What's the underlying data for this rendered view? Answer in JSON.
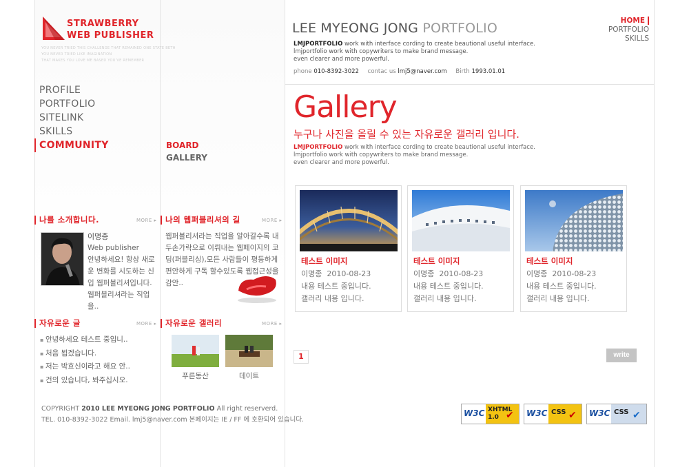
{
  "logo": {
    "line1": "STRAWBERRY",
    "line2": "WEB PUBLISHER",
    "tagline": [
      "YOU NEVER TRIED THIS CHALLENGE THAT REMAINED ONE STATE BETH",
      "YOU NEVER TRIED LIKE IMAGINATION",
      "THAT MAKES YOU LOVE ME BASED YOU'VE REMEMBER"
    ]
  },
  "menu": {
    "items": [
      "PROFILE",
      "PORTFOLIO",
      "SITELINK",
      "SKILLS",
      "COMMUNITY"
    ],
    "active": "COMMUNITY"
  },
  "submenu": [
    "BOARD",
    "GALLERY"
  ],
  "header": {
    "title_dark": "LEE MYEONG JONG",
    "title_light": "PORTFOLIO",
    "intro_brand": "LMJPORTFOLIO",
    "intro_line1": " work with interface cording to create beautional useful interface.",
    "intro_line2": "lmjportfolio work with copywriters to make brand message.",
    "intro_line3": "even clearer and more powerful.",
    "phone_label": "phone",
    "phone": "010-8392-3022",
    "contact_label": "contac us",
    "email": "lmj5@naver.com",
    "birth_label": "Birth",
    "birth": "1993.01.01"
  },
  "topnav": [
    "HOME",
    "PORTFOLIO",
    "SKILLS"
  ],
  "gallery": {
    "title": "Gallery",
    "subtitle": "누구나 사진을 올릴 수 있는 자유로운 갤러리 입니다.",
    "desc_brand": "LMJPORTFOLIO",
    "desc_line1": " work with interface cording to create beautional useful interface.",
    "desc_line2": "lmjportfolio work with copywriters to make brand message.",
    "desc_line3": "even clearer and more powerful.",
    "cards": [
      {
        "title": "테스트 이미지",
        "author": "이명종",
        "date": "2010-08-23",
        "line1": "내용 테스트 중입니다.",
        "line2": "갤러리 내용 입니다."
      },
      {
        "title": "테스트 이미지",
        "author": "이명종",
        "date": "2010-08-23",
        "line1": "내용 테스트 중입니다.",
        "line2": "갤러리 내용 입니다."
      },
      {
        "title": "테스트 이미지",
        "author": "이명종",
        "date": "2010-08-23",
        "line1": "내용 테스트 중입니다.",
        "line2": "갤러리 내용 입니다."
      }
    ],
    "page": "1",
    "write": "write"
  },
  "widgets": {
    "more": "MORE ▸",
    "intro_title": "나를 소개합니다.",
    "intro_name": "이명종",
    "intro_role": "Web publisher",
    "intro_text": "안녕하세요! 항상 새로운 변화를 시도하는 신입 웹퍼블리셔입니다. 웹퍼블리셔라는 직업을..",
    "road_title": "나의 웹퍼블리셔의 길",
    "road_text": "웹퍼블리셔라는 직업을 알아갈수록 내두손가락으로 이뤄내는 웹페이지의 코딩(퍼블리싱),모든 사람들이 평등하게 편안하게 구독 할수있도록 웹접근성을 감안..",
    "free_title": "자유로운 글",
    "free_items": [
      "안녕하세요 테스트 중입니..",
      "처음 뵙겠습니다.",
      "저는 박효신이라고 해요 안..",
      "건의 있습니다, 봐주십시오."
    ],
    "gal_title": "자유로운 갤러리",
    "gal_thumbs": [
      "푸른동산",
      "데이트"
    ]
  },
  "footer": {
    "copy_prefix": "COPYRIGHT",
    "copy_bold": "2010 LEE MYEONG JONG PORTFOLIO",
    "copy_suffix": "All right reserverd.",
    "line2": "TEL. 010-8392-3022 Email. lmj5@naver.com 본페이지는 IE / FF 에 호환되어 있습니다.",
    "badges": [
      "XHTML 1.0",
      "CSS",
      "CSS"
    ]
  },
  "colors": {
    "accent": "#e0252b",
    "text": "#666666",
    "line": "#e4e4e4"
  }
}
